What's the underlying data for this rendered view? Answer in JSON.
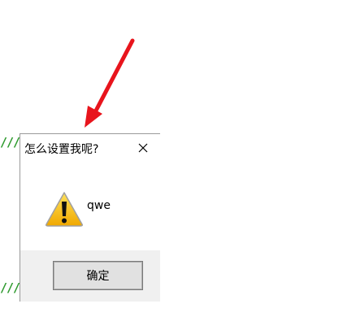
{
  "background": {
    "code_fragments": [
      "///",
      "///"
    ],
    "code_color": "#2e9a2e"
  },
  "annotation": {
    "arrow_color": "#e8141c",
    "arrow_icon": "red-arrow-icon"
  },
  "dialog": {
    "title": "怎么设置我呢?",
    "close_icon": "close-icon",
    "icon": "warning-icon",
    "message": "qwe",
    "ok_label": "确定",
    "footer_color": "#f0f0f0"
  }
}
